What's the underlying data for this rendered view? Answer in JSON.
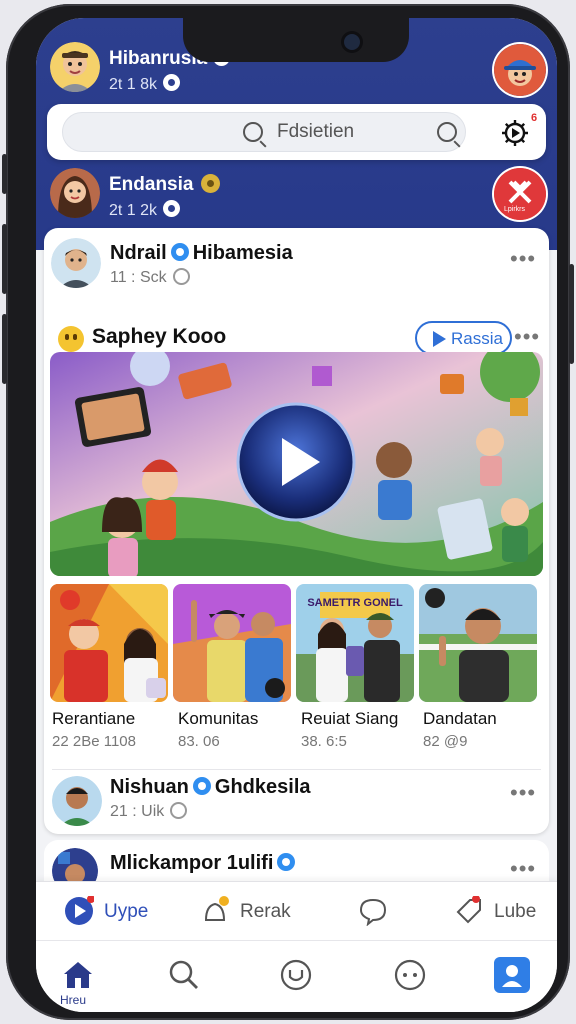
{
  "header": {
    "user1": {
      "name": "Hibanrusia",
      "meta": "2t 1 8k"
    },
    "search": {
      "placeholder": "Fdsietien"
    },
    "user2": {
      "name": "Endansia",
      "meta": "2t 1 2k"
    },
    "user2_badge": "Lpirkrs"
  },
  "post1": {
    "name": "Ndrail",
    "name2": "Hibamesia",
    "meta": "11 : Sck"
  },
  "section": {
    "title": "Saphey Kooo",
    "play_label": "Rassia"
  },
  "thumbs": [
    {
      "title": "Rerantiane",
      "meta": "22 2Be 1108"
    },
    {
      "title": "Komunitas",
      "meta": "83. 06"
    },
    {
      "title": "Reuiat Siang",
      "meta": "38. 6:5",
      "overlay": "SAMETTR GONEL"
    },
    {
      "title": "Dandatan",
      "meta": "82 @9"
    }
  ],
  "post2": {
    "name": "Nishuan",
    "name2": "Ghdkesila",
    "meta": "21 : Uik"
  },
  "post3": {
    "name": "Mlickampor 1ulifi"
  },
  "tabs": [
    {
      "label": "Uype",
      "icon": "play-circle-icon"
    },
    {
      "label": "Rerak",
      "icon": "bell-icon"
    },
    {
      "label": "",
      "icon": "chat-bubble-icon"
    },
    {
      "label": "Lube",
      "icon": "tag-icon"
    }
  ],
  "nav": {
    "home_label": "Hreu"
  },
  "colors": {
    "header_blue": "#2d3f8e",
    "accent_blue": "#2f6fd6",
    "badge_blue": "#2f8ef0"
  }
}
